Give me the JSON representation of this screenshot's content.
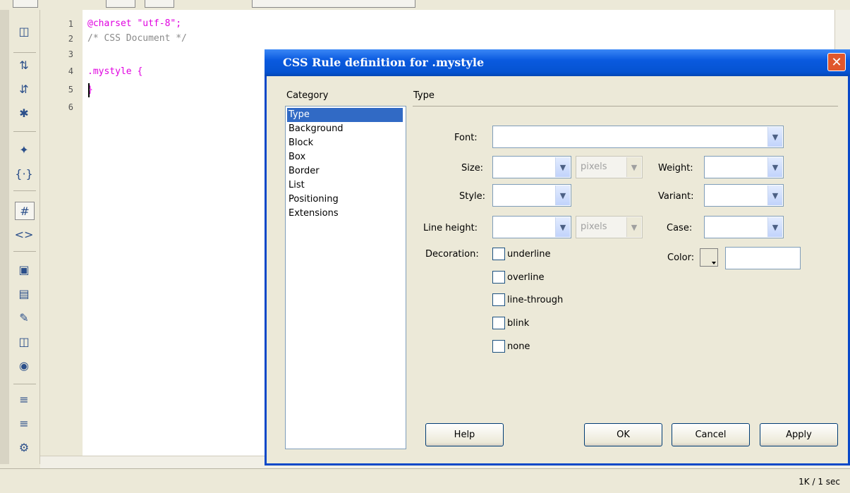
{
  "editor": {
    "line_numbers": [
      "1",
      "2",
      "3",
      "4",
      "5",
      "6"
    ],
    "lines": [
      {
        "text": "@charset \"utf-8\";",
        "color": "#e000e0"
      },
      {
        "text": "/* CSS Document */",
        "color": "#8a8a8a"
      },
      {
        "text": "",
        "color": "#000000"
      },
      {
        "text": ".mystyle {",
        "color": "#e000e0"
      },
      {
        "text": "}",
        "color": "#e000e0"
      },
      {
        "text": "",
        "color": "#000000"
      }
    ]
  },
  "status": {
    "size_time": "1K / 1 sec"
  },
  "dialog": {
    "title": "CSS Rule definition for .mystyle",
    "category_header": "Category",
    "section_title": "Type",
    "categories": [
      "Type",
      "Background",
      "Block",
      "Box",
      "Border",
      "List",
      "Positioning",
      "Extensions"
    ],
    "selected_category": "Type",
    "fields": {
      "font_label": "Font:",
      "size_label": "Size:",
      "size_unit": "pixels",
      "weight_label": "Weight:",
      "style_label": "Style:",
      "variant_label": "Variant:",
      "line_height_label": "Line height:",
      "line_height_unit": "pixels",
      "case_label": "Case:",
      "decoration_label": "Decoration:",
      "color_label": "Color:"
    },
    "decorations": [
      "underline",
      "overline",
      "line-through",
      "blink",
      "none"
    ],
    "buttons": {
      "help": "Help",
      "ok": "OK",
      "cancel": "Cancel",
      "apply": "Apply"
    }
  },
  "colors": {
    "title_bar": "#0a5adf",
    "selection": "#316ac5",
    "close_button": "#e0572c"
  }
}
